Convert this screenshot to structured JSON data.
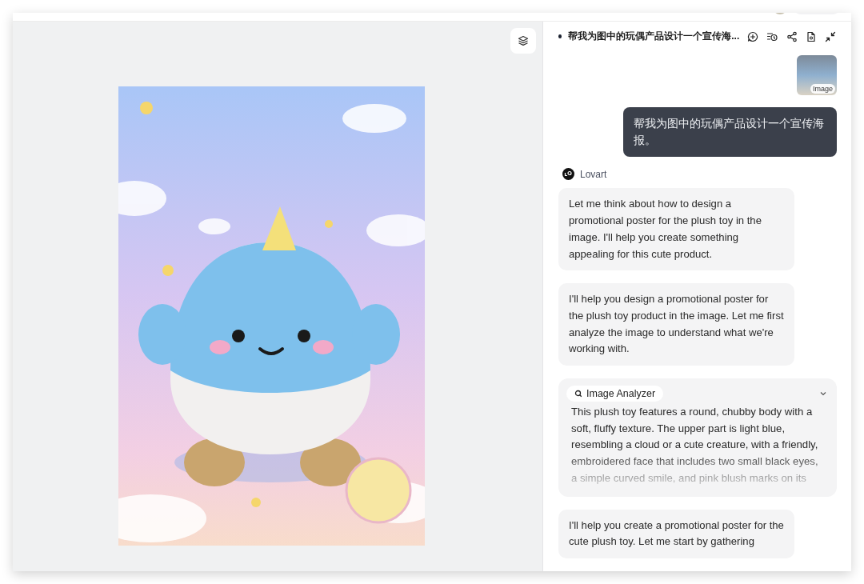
{
  "chat": {
    "title": "帮我为图中的玩偶产品设计一个宣传海...",
    "attachment": {
      "label": "Image"
    },
    "user_message": "帮我为图中的玩偶产品设计一个宣传海报。",
    "assistant": {
      "name": "Lovart"
    },
    "messages": [
      {
        "kind": "text",
        "text": "Let me think about how to design a promotional poster for the plush toy in the image. I'll help you create something appealing for this cute product."
      },
      {
        "kind": "text",
        "text": "I'll help you design a promotional poster for the plush toy product in the image. Let me first analyze the image to understand what we're working with."
      },
      {
        "kind": "tool",
        "tool": "Image Analyzer",
        "expanded": false,
        "text": "This plush toy features a round, chubby body with a soft, fluffy texture. The upper part is light blue, resembling a cloud or a cute creature, with a friendly, embroidered face that includes two small black eyes, a simple curved smile, and pink blush marks on its"
      },
      {
        "kind": "text",
        "text": "I'll help you create a promotional poster for the cute plush toy. Let me start by gathering"
      }
    ]
  }
}
